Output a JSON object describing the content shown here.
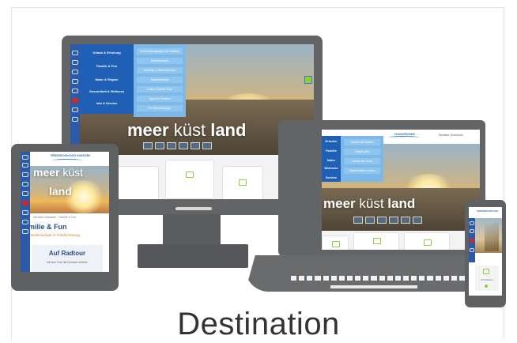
{
  "caption": "Destination",
  "brand": {
    "logo": "OGNORDSEE",
    "tagline": "Urlaub land",
    "partner": "Nordsee-Tourismus"
  },
  "hero": {
    "word1": "meer",
    "word2": "küst",
    "word3": "land"
  },
  "monitor": {
    "menu": [
      "Urlaub & Erholung",
      "Familie & Fun",
      "Natur & Region",
      "Gesundheit & Wellness",
      "Info & Service"
    ],
    "submenu": [
      "Veranstaltungstipps für Familien",
      "Erlebnisurlaub",
      "Ausflüge & Erlebnistouren",
      "Radfahrerblick",
      "Unsere Spieler Spiel",
      "Tipps für Familien",
      "Für Reiseanfänger"
    ]
  },
  "laptop": {
    "menu": [
      "Erholen",
      "Familie",
      "Natur",
      "Wellness",
      "Service"
    ],
    "submenu": [
      "Urlaub mit Kindern",
      "Urlaub aktiv",
      "Urlaub mit Hund",
      "Urlaub online buchen"
    ]
  },
  "tablet": {
    "logo": "FRIEDRICHSKOOG NORDSEE",
    "hero_word1": "meer",
    "hero_word2": "küst",
    "hero_word3": "land",
    "breadcrumb": "Nordsee-Startseite · Familie & Fun",
    "section_title": "milie & Fun",
    "section_subtitle": "Familienurlaub in Friedrichskoog",
    "card_title": "Auf Radtour",
    "card_text": "mit dem Rad die Nordsee erleben"
  },
  "phone": {
    "logo": "FRIEDRICHSKOOG",
    "card_label": "Auf Radtour"
  },
  "colors": {
    "device_gray": "#636466",
    "menu_blue": "#1f5fb5",
    "submenu_blue": "#7cb8e8",
    "accent_red": "#d02828",
    "accent_green": "#8ccf3c"
  }
}
